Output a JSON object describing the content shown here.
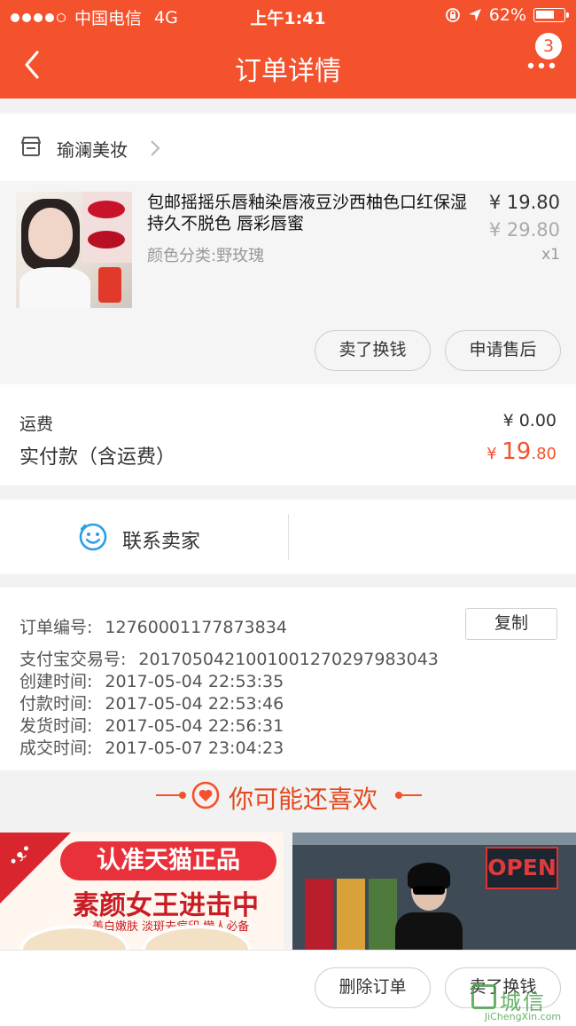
{
  "status_bar": {
    "carrier": "中国电信",
    "network": "4G",
    "time": "上午1:41",
    "battery": "62%"
  },
  "nav": {
    "title": "订单详情",
    "more_badge": "3"
  },
  "shop": {
    "name": "瑜澜美妆"
  },
  "item": {
    "title": "包邮摇摇乐唇釉染唇液豆沙西柚色口红保湿 持久不脱色 唇彩唇蜜",
    "sku": "颜色分类:野玫瑰",
    "price": "¥ 19.80",
    "original_price": "¥ 29.80",
    "quantity": "x1",
    "buttons": {
      "sell": "卖了换钱",
      "after_sale": "申请售后"
    }
  },
  "fees": {
    "shipping_label": "运费",
    "shipping_value": "¥ 0.00",
    "paid_label": "实付款（含运费）",
    "paid_currency": "¥",
    "paid_int": "19",
    "paid_dec": ".80"
  },
  "contact": {
    "label": "联系卖家"
  },
  "order_info": {
    "copy_button": "复制",
    "rows": [
      {
        "label": "订单编号:",
        "value": "12760001177873834"
      },
      {
        "label": "支付宝交易号:",
        "value": "2017050421001001270297983043"
      },
      {
        "label": "创建时间:",
        "value": "2017-05-04 22:53:35"
      },
      {
        "label": "付款时间:",
        "value": "2017-05-04 22:53:46"
      },
      {
        "label": "发货时间:",
        "value": "2017-05-04 22:56:31"
      },
      {
        "label": "成交时间:",
        "value": "2017-05-07 23:04:23"
      }
    ]
  },
  "recommend": {
    "title": "你可能还喜欢",
    "promo1": {
      "banner": "认准天猫正品",
      "headline": "素颜女王进击中",
      "sub": "美白嫩肤  淡斑去痘印  懒人必备"
    },
    "promo2": {
      "sign": "OPEN"
    }
  },
  "bottom_bar": {
    "delete": "删除订单",
    "sell": "卖了换钱"
  },
  "watermark": {
    "text": "城信",
    "url": "JiChengXin.com"
  },
  "colors": {
    "accent": "#f4512d",
    "price_red": "#f4512d",
    "contact_icon": "#2a9ee8"
  }
}
